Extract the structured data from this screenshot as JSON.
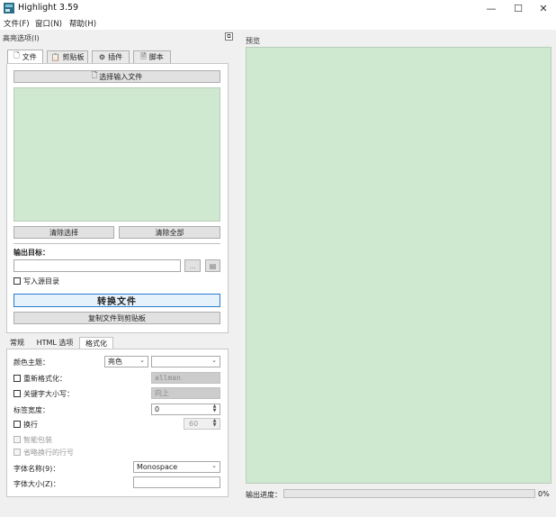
{
  "window": {
    "title": "Highlight 3.59",
    "minimize": "—",
    "maximize": "☐",
    "close": "✕"
  },
  "menu": [
    "文件(F)",
    "窗口(N)",
    "帮助(H)"
  ],
  "left_dock": {
    "title": "高亮选项(I)",
    "tabs": [
      "文件",
      "剪贴板",
      "插件",
      "脚本"
    ],
    "select_input_button": "选择输入文件",
    "clear_selection_button": "清除选择",
    "clear_all_button": "清除全部",
    "output_target_label": "输出目标：",
    "browse_button": "...",
    "write_to_source_dir": "写入源目录",
    "convert_button": "转换文件",
    "copy_to_clipboard_button": "复制文件到剪贴板"
  },
  "format_tabs": [
    "常规",
    "HTML 选项",
    "格式化"
  ],
  "format": {
    "color_theme_label": "颜色主题：",
    "color_theme_value": "亮色",
    "reformat_label": "重新格式化：",
    "reformat_value": "allman",
    "keyword_case_label": "关键字大小写：",
    "keyword_case_value": "向上",
    "tab_width_label": "标签宽度：",
    "tab_width_value": "0",
    "line_wrap_label": "换行",
    "line_wrap_value": "60",
    "smart_wrap_label": "智能包装",
    "omit_wrapped_numbers_label": "省略换行的行号",
    "font_name_label": "字体名称(9)：",
    "font_name_value": "Monospace",
    "font_size_label": "字体大小(Z)："
  },
  "preview": {
    "title": "预览",
    "progress_label": "输出进度：",
    "progress_text": "0%",
    "progress_value": 0
  },
  "colors": {
    "preview_green": "#cfe8d0",
    "accent": "#2b7bd1"
  }
}
